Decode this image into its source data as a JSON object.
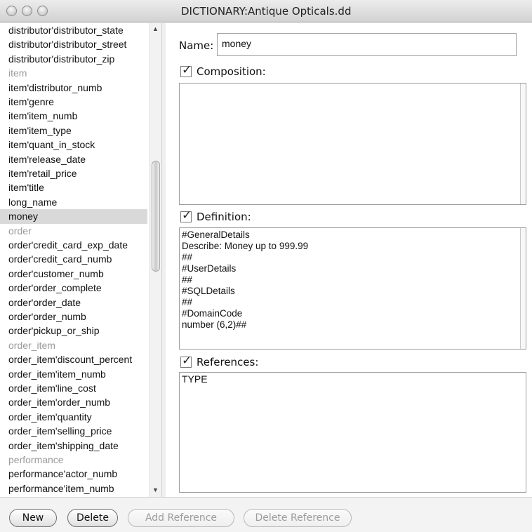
{
  "window": {
    "title": "DICTIONARY:Antique Opticals.dd"
  },
  "list": {
    "items": [
      {
        "label": "distributor'distributor_state",
        "kind": "field"
      },
      {
        "label": "distributor'distributor_street",
        "kind": "field"
      },
      {
        "label": "distributor'distributor_zip",
        "kind": "field"
      },
      {
        "label": "item",
        "kind": "table"
      },
      {
        "label": "item'distributor_numb",
        "kind": "field"
      },
      {
        "label": "item'genre",
        "kind": "field"
      },
      {
        "label": "item'item_numb",
        "kind": "field"
      },
      {
        "label": "item'item_type",
        "kind": "field"
      },
      {
        "label": "item'quant_in_stock",
        "kind": "field"
      },
      {
        "label": "item'release_date",
        "kind": "field"
      },
      {
        "label": "item'retail_price",
        "kind": "field"
      },
      {
        "label": "item'title",
        "kind": "field"
      },
      {
        "label": "long_name",
        "kind": "field"
      },
      {
        "label": "money",
        "kind": "selected"
      },
      {
        "label": "order",
        "kind": "table"
      },
      {
        "label": "order'credit_card_exp_date",
        "kind": "field"
      },
      {
        "label": "order'credit_card_numb",
        "kind": "field"
      },
      {
        "label": "order'customer_numb",
        "kind": "field"
      },
      {
        "label": "order'order_complete",
        "kind": "field"
      },
      {
        "label": "order'order_date",
        "kind": "field"
      },
      {
        "label": "order'order_numb",
        "kind": "field"
      },
      {
        "label": "order'pickup_or_ship",
        "kind": "field"
      },
      {
        "label": "order_item",
        "kind": "table"
      },
      {
        "label": "order_item'discount_percent",
        "kind": "field"
      },
      {
        "label": "order_item'item_numb",
        "kind": "field"
      },
      {
        "label": "order_item'line_cost",
        "kind": "field"
      },
      {
        "label": "order_item'order_numb",
        "kind": "field"
      },
      {
        "label": "order_item'quantity",
        "kind": "field"
      },
      {
        "label": "order_item'selling_price",
        "kind": "field"
      },
      {
        "label": "order_item'shipping_date",
        "kind": "field"
      },
      {
        "label": "performance",
        "kind": "table"
      },
      {
        "label": "performance'actor_numb",
        "kind": "field"
      },
      {
        "label": "performance'item_numb",
        "kind": "field"
      }
    ]
  },
  "form": {
    "name_label": "Name:",
    "name_value": "money",
    "composition_label": "Composition:",
    "definition_label": "Definition:",
    "definition_lines": [
      "#GeneralDetails",
      "Describe: Money up to 999.99",
      "##",
      "#UserDetails",
      "##",
      "#SQLDetails",
      "##",
      "#DomainCode",
      "number (6,2)##"
    ],
    "references_label": "References:",
    "references_value": "TYPE"
  },
  "buttons": {
    "new": "New",
    "delete": "Delete",
    "add_reference": "Add Reference",
    "delete_reference": "Delete Reference"
  }
}
